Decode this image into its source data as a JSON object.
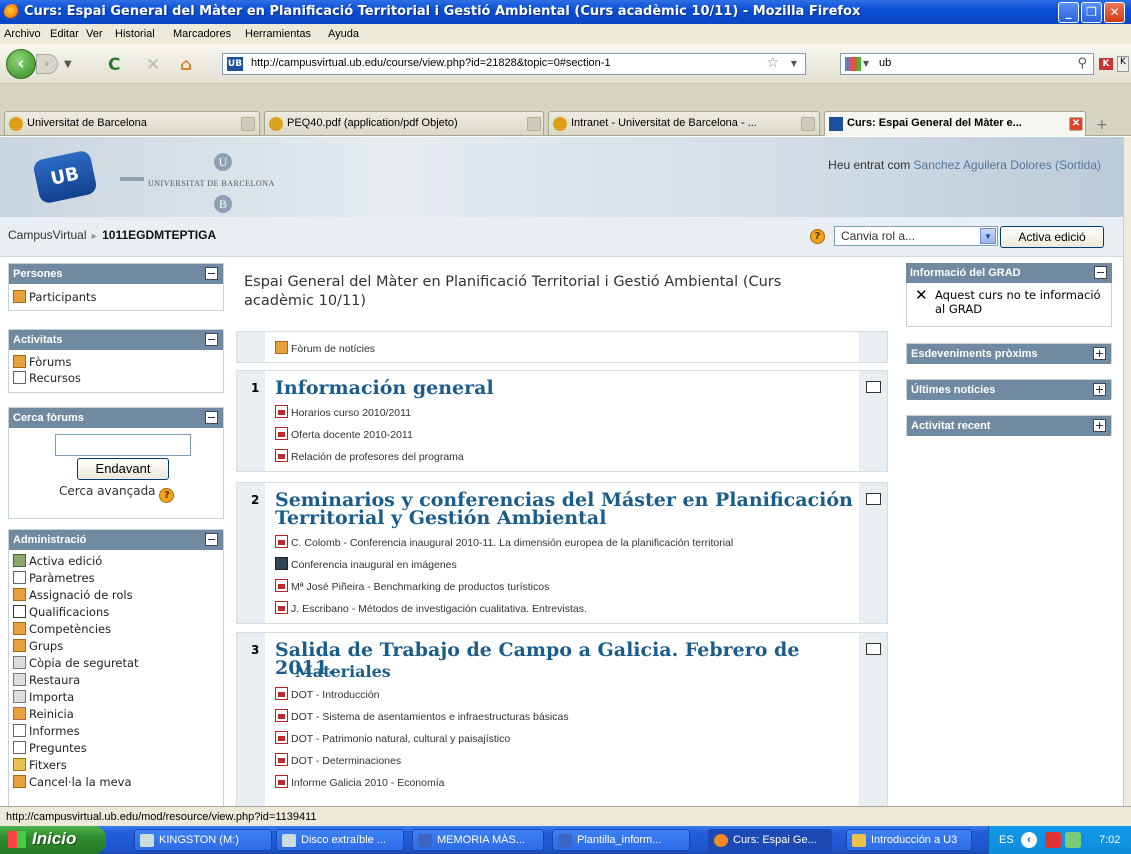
{
  "window": {
    "title": "Curs: Espai General del Màter en Planificació Territorial i Gestió Ambiental (Curs acadèmic 10/11) - Mozilla Firefox"
  },
  "menu": [
    "Archivo",
    "Editar",
    "Ver",
    "Historial",
    "Marcadores",
    "Herramientas",
    "Ayuda"
  ],
  "nav": {
    "url": "http://campusvirtual.ub.edu/course/view.php?id=21828&topic=0#section-1",
    "search_value": "ub"
  },
  "tabs": [
    {
      "label": "Universitat de Barcelona"
    },
    {
      "label": "PEQ40.pdf (application/pdf Objeto)"
    },
    {
      "label": "Intranet - Universitat de Barcelona - ..."
    },
    {
      "label": "Curs: Espai General del Màter e..."
    }
  ],
  "banner": {
    "logo": "UB",
    "university": "UNIVERSITAT DE BARCELONA",
    "mono_top": "U",
    "mono_bottom": "B",
    "login_prefix": "Heu entrat com",
    "login_name": "Sanchez Aguilera Dolores",
    "logout": "(Sortida)"
  },
  "breadcrumb": {
    "home": "CampusVirtual",
    "sep": "►",
    "course": "1011EGDMTEPTIGA"
  },
  "controls": {
    "role_select": "Canvia rol a...",
    "edit_button": "Activa edició"
  },
  "left": {
    "persones": {
      "title": "Persones",
      "items": [
        "Participants"
      ]
    },
    "activitats": {
      "title": "Activitats",
      "items": [
        "Fòrums",
        "Recursos"
      ]
    },
    "cerca": {
      "title": "Cerca fòrums",
      "input": "",
      "button": "Endavant",
      "advanced": "Cerca avançada"
    },
    "admin": {
      "title": "Administració",
      "items": [
        "Activa edició",
        "Paràmetres",
        "Assignació de rols",
        "Qualificacions",
        "Competències",
        "Grups",
        "Còpia de seguretat",
        "Restaura",
        "Importa",
        "Reinicia",
        "Informes",
        "Preguntes",
        "Fitxers",
        "Cancel·la la meva"
      ]
    }
  },
  "course": {
    "title": "Espai General del Màter en Planificació Territorial i Gestió Ambiental (Curs acadèmic 10/11)",
    "forum": "Fòrum de notícies",
    "sections": [
      {
        "num": "1",
        "title": "Información general",
        "items": [
          "Horarios curso 2010/2011",
          "Oferta docente 2010-2011",
          "Relación de profesores del programa"
        ]
      },
      {
        "num": "2",
        "title": "Seminarios y conferencias del Máster en Planificación Territorial y Gestión Ambiental",
        "items": [
          "C. Colomb - Conferencia inaugural 2010-11. La dimensión europea de la planificación territorial",
          "Conferencia inaugural en imágenes",
          "Mª José Piñeira - Benchmarking de productos turísticos",
          "J. Escribano - Métodos de investigación cualitativa. Entrevistas."
        ]
      },
      {
        "num": "3",
        "title": "Salida de Trabajo de Campo a Galicia. Febrero de 2011.",
        "subtitle": "Materiales",
        "items": [
          "DOT - Introducción",
          "DOT - Sistema de asentamientos e infraestructuras básicas",
          "DOT - Patrimonio natural, cultural y paisajístico",
          "DOT - Determinaciones",
          "Informe Galicia 2010 - Economía"
        ]
      }
    ]
  },
  "right": {
    "grad": {
      "title": "Informació del GRAD",
      "text": "Aquest curs no te informació al GRAD"
    },
    "events": {
      "title": "Esdeveniments pròxims"
    },
    "news": {
      "title": "Últimes notícies"
    },
    "recent": {
      "title": "Activitat recent"
    }
  },
  "statusbar": "http://campusvirtual.ub.edu/mod/resource/view.php?id=1139411",
  "taskbar": {
    "start": "Inicio",
    "tasks": [
      "KINGSTON (M:)",
      "Disco extraíble ...",
      "MEMORIA MÁS...",
      "Plantilla_inform...",
      "Curs: Espai Ge...",
      "Introducción a U3"
    ],
    "lang": "ES",
    "clock": "7:02"
  }
}
